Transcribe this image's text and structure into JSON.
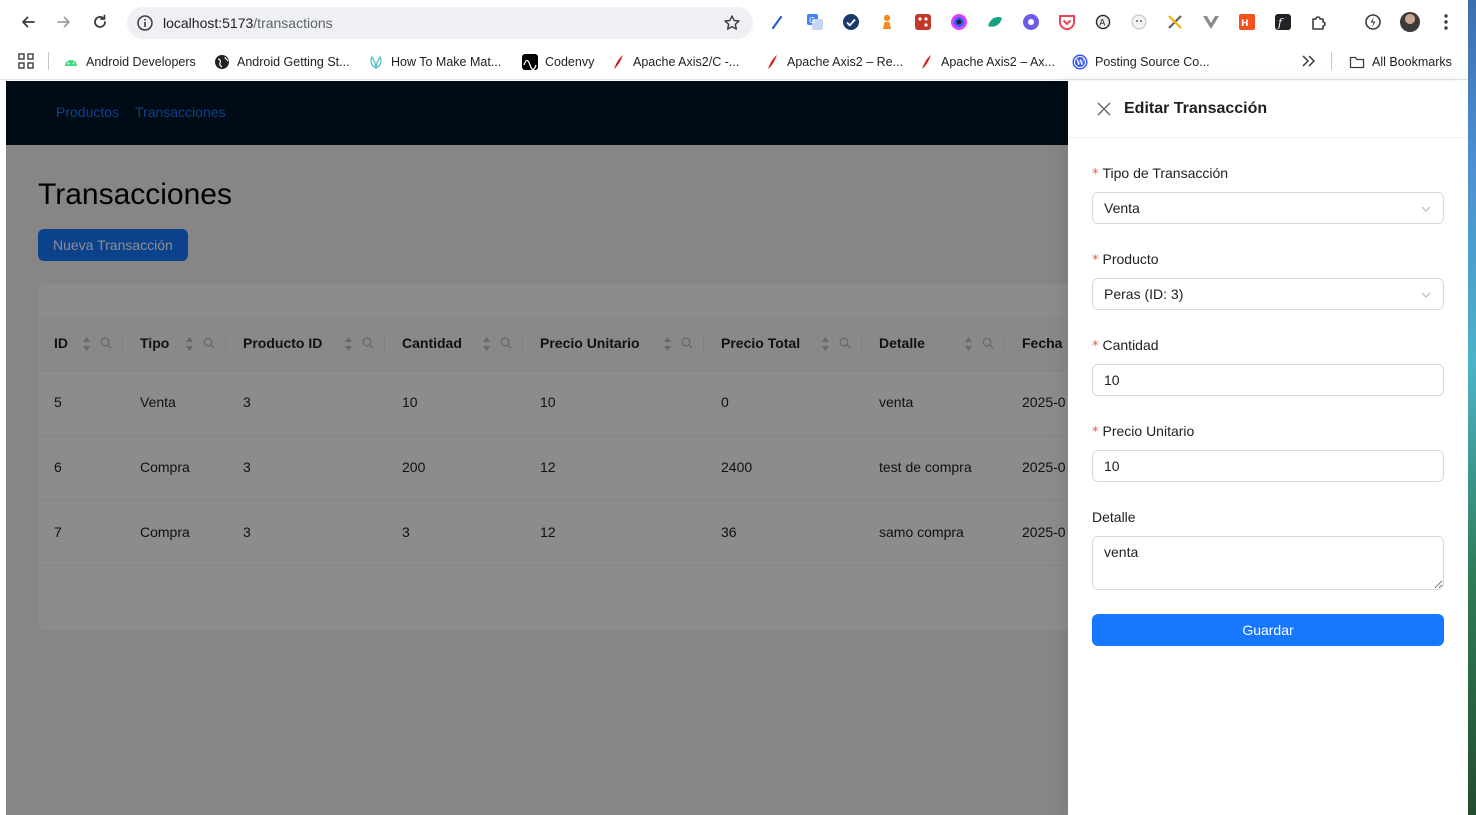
{
  "browser": {
    "url_host": "localhost:5173",
    "url_path": "/transactions",
    "bookmarks": [
      {
        "label": "Android Developers",
        "icon": "android-icon",
        "color": "#3ddc84"
      },
      {
        "label": "Android Getting St...",
        "icon": "globe-icon",
        "color": "#202124"
      },
      {
        "label": "How To Make Mat...",
        "icon": "lotus-icon",
        "color": "#4fc3c8"
      },
      {
        "label": "Codenvy",
        "icon": "codenvy-icon",
        "color": "#000000"
      },
      {
        "label": "Apache Axis2/C -...",
        "icon": "apache-feather-icon",
        "color": "#d22128"
      },
      {
        "label": "Apache Axis2 – Re...",
        "icon": "apache-feather-icon",
        "color": "#d22128"
      },
      {
        "label": "Apache Axis2 – Ax...",
        "icon": "apache-feather-icon",
        "color": "#d22128"
      },
      {
        "label": "Posting Source Co...",
        "icon": "wordpress-icon",
        "color": "#3858e9"
      }
    ],
    "all_bookmarks": "All Bookmarks"
  },
  "nav": {
    "products": "Productos",
    "transactions": "Transacciones"
  },
  "main": {
    "title": "Transacciones",
    "new_button": "Nueva Transacción"
  },
  "table": {
    "columns": [
      "ID",
      "Tipo",
      "Producto ID",
      "Cantidad",
      "Precio Unitario",
      "Precio Total",
      "Detalle",
      "Fecha"
    ],
    "rows": [
      [
        "5",
        "Venta",
        "3",
        "10",
        "10",
        "0",
        "venta",
        "2025-0"
      ],
      [
        "6",
        "Compra",
        "3",
        "200",
        "12",
        "2400",
        "test de compra",
        "2025-0"
      ],
      [
        "7",
        "Compra",
        "3",
        "3",
        "12",
        "36",
        "samo compra",
        "2025-0"
      ]
    ]
  },
  "drawer": {
    "title": "Editar Transacción",
    "fields": {
      "type_label": "Tipo de Transacción",
      "type_value": "Venta",
      "product_label": "Producto",
      "product_value": "Peras (ID: 3)",
      "quantity_label": "Cantidad",
      "quantity_value": "10",
      "unit_price_label": "Precio Unitario",
      "unit_price_value": "10",
      "detail_label": "Detalle",
      "detail_value": "venta"
    },
    "required_mark": "*",
    "save_button": "Guardar"
  },
  "colors": {
    "primary": "#1677ff",
    "header_bg": "#001529",
    "required": "#ff4d4f"
  }
}
